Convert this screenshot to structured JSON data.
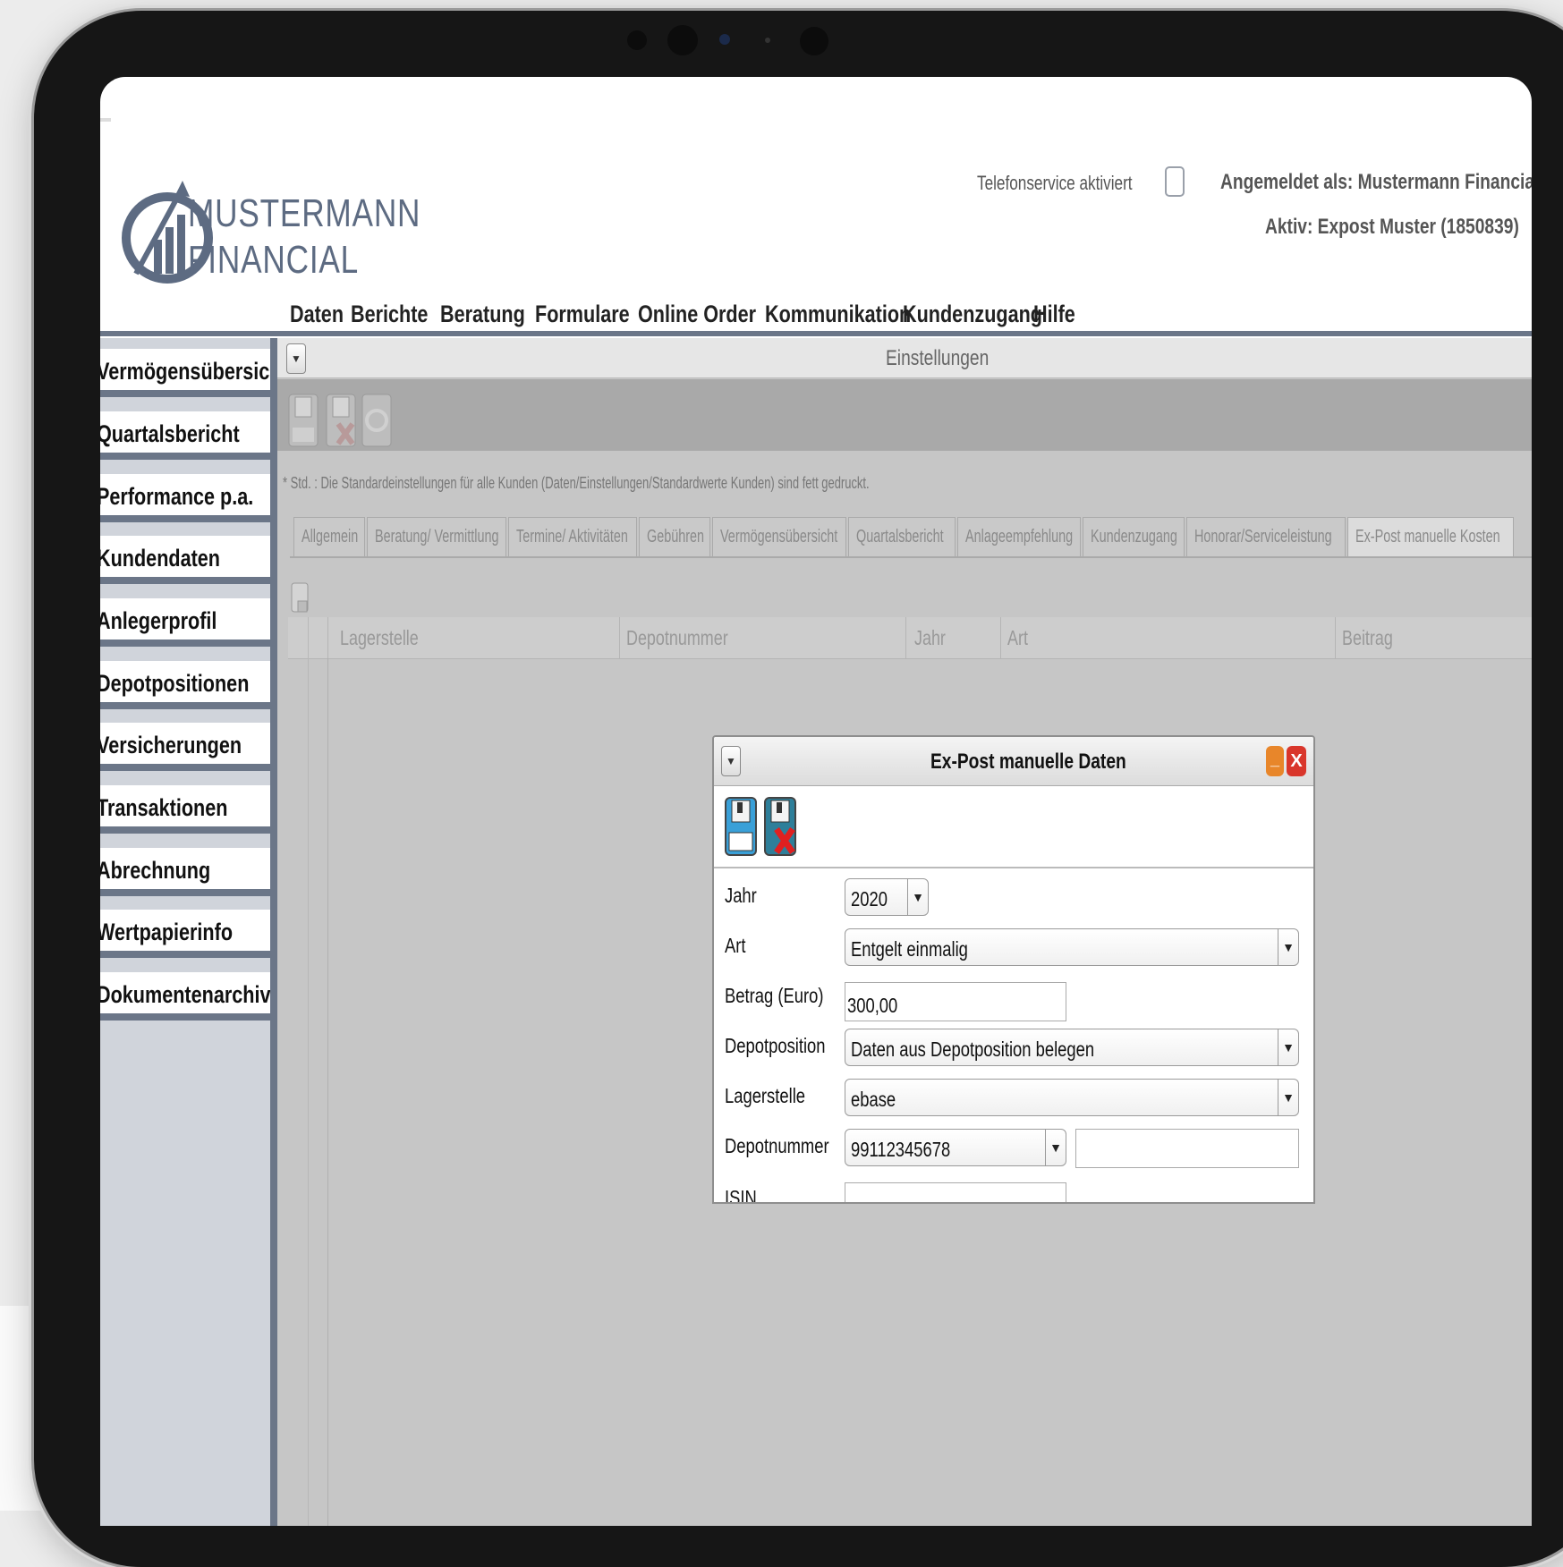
{
  "brand": {
    "line1": "MUSTERMANN",
    "line2": "FINANCIAL"
  },
  "header": {
    "telefonservice": "Telefonservice aktiviert",
    "angemeldet": "Angemeldet als: Mustermann Financial",
    "aktiv": "Aktiv: Expost Muster (1850839)"
  },
  "menu": [
    "Daten",
    "Berichte",
    "Beratung",
    "Formulare",
    "Online Order",
    "Kommunikation",
    "Kundenzugang",
    "Hilfe"
  ],
  "sidebar": [
    "Vermögensübersicht",
    "Quartalsbericht",
    "Performance p.a.",
    "Kundendaten",
    "Anlegerprofil",
    "Depotpositionen",
    "Versicherungen",
    "Transaktionen",
    "Abrechnung",
    "Wertpapierinfo",
    "Dokumentenarchiv"
  ],
  "panel": {
    "title": "Einstellungen",
    "note": "* Std. : Die Standardeinstellungen für alle Kunden (Daten/Einstellungen/Standardwerte Kunden) sind fett gedruckt.",
    "tabs": [
      "Allgemein",
      "Beratung/ Vermittlung",
      "Termine/ Aktivitäten",
      "Gebühren",
      "Vermögensübersicht",
      "Quartalsbericht",
      "Anlageempfehlung",
      "Kundenzugang",
      "Honorar/Serviceleistung",
      "Ex-Post manuelle Kosten"
    ],
    "columns": [
      "Lagerstelle",
      "Depotnummer",
      "Jahr",
      "Art",
      "Beitrag"
    ]
  },
  "dialog": {
    "title": "Ex-Post manuelle Daten",
    "labels": {
      "jahr": "Jahr",
      "art": "Art",
      "betrag": "Betrag (Euro)",
      "depotposition": "Depotposition",
      "lagerstelle": "Lagerstelle",
      "depotnummer": "Depotnummer",
      "isin": "ISIN"
    },
    "values": {
      "jahr": "2020",
      "art": "Entgelt einmalig",
      "betrag": "300,00",
      "depotposition": "Daten aus Depotposition belegen",
      "lagerstelle": "ebase",
      "depotnummer": "99112345678",
      "depotnummer_extra": "",
      "isin": ""
    },
    "minimize": "_",
    "close": "X"
  },
  "colors": {
    "accent": "#6b7688",
    "close": "#d9362b",
    "minimize": "#e8862a",
    "floppy": "#3aa0d8"
  }
}
